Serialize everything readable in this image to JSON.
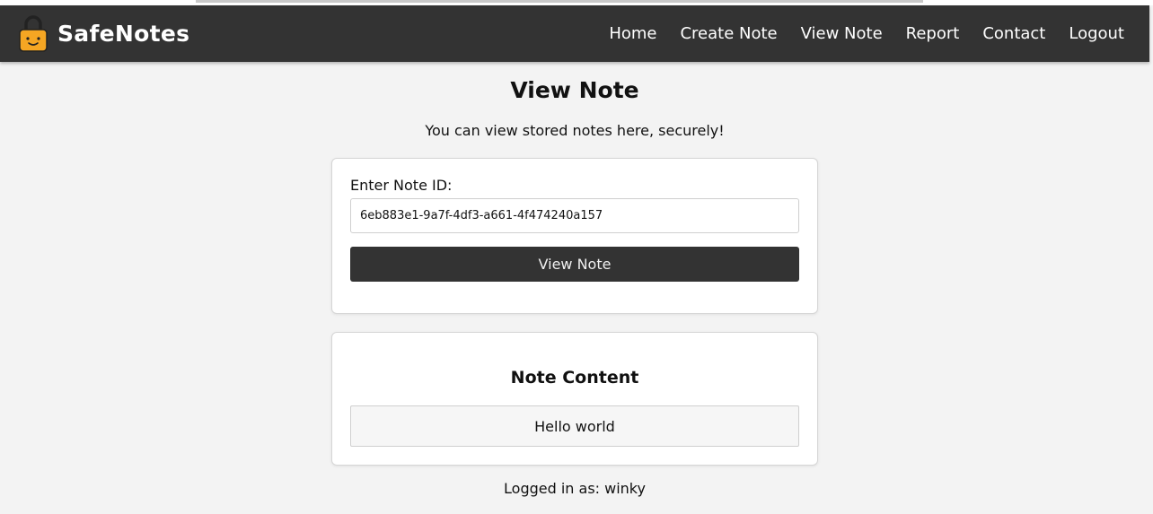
{
  "app": {
    "name": "SafeNotes"
  },
  "nav": {
    "items": [
      {
        "label": "Home"
      },
      {
        "label": "Create Note"
      },
      {
        "label": "View Note"
      },
      {
        "label": "Report"
      },
      {
        "label": "Contact"
      },
      {
        "label": "Logout"
      }
    ]
  },
  "page": {
    "title": "View Note",
    "subtitle": "You can view stored notes here, securely!"
  },
  "form": {
    "label": "Enter Note ID:",
    "note_id_value": "6eb883e1-9a7f-4df3-a661-4f474240a157",
    "submit_label": "View Note"
  },
  "note": {
    "heading": "Note Content",
    "content": "Hello world"
  },
  "footer": {
    "logged_in_text": "Logged in as: winky"
  },
  "colors": {
    "navbar": "#333333",
    "background": "#f3f3f3",
    "logo_accent": "#f5a623",
    "button": "#333333"
  },
  "icons": {
    "logo": "padlock-smile-icon"
  }
}
